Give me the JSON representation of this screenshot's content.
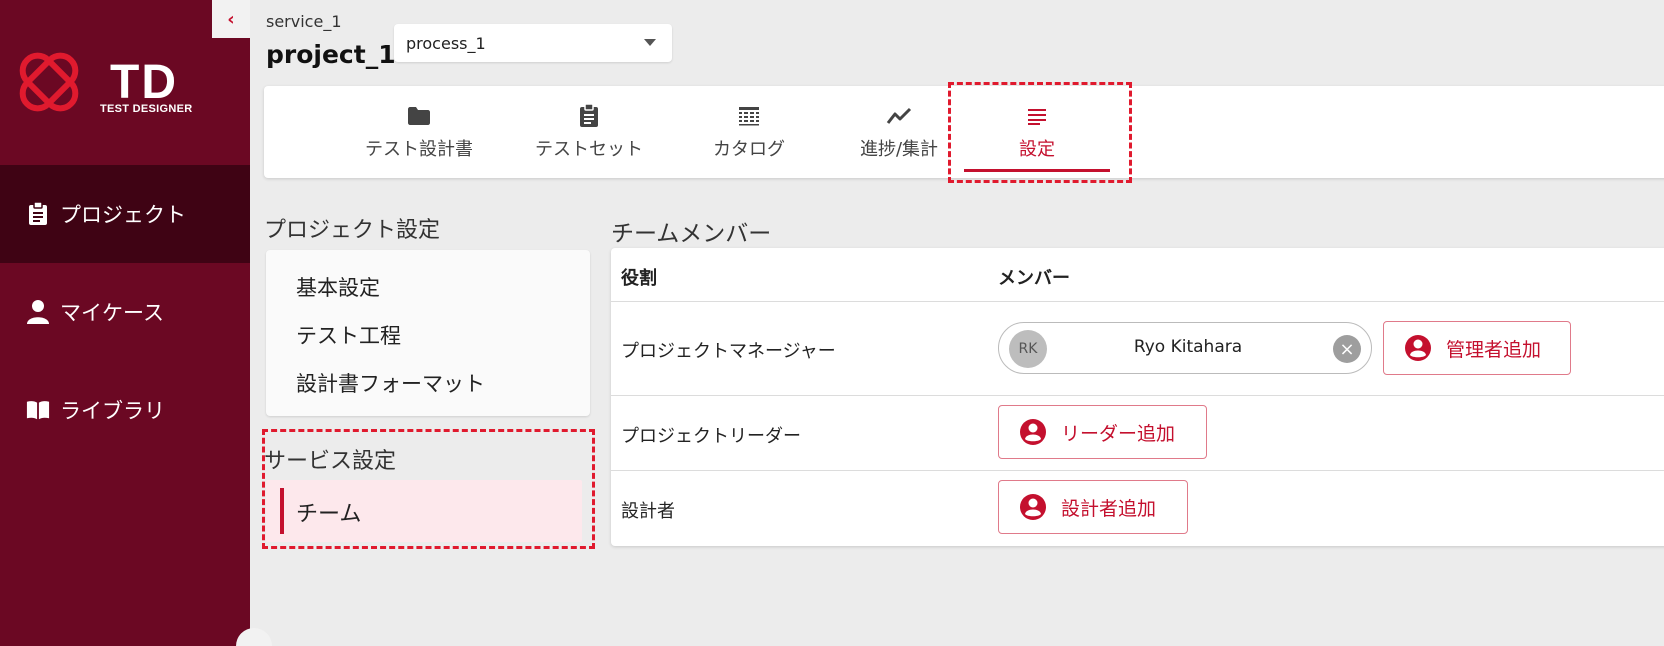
{
  "app": {
    "logo_text": "TD",
    "logo_subtitle": "TEST DESIGNER"
  },
  "sidebar": {
    "items": [
      {
        "label": "プロジェクト",
        "icon": "clipboard-icon",
        "active": true
      },
      {
        "label": "マイケース",
        "icon": "person-icon",
        "active": false
      },
      {
        "label": "ライブラリ",
        "icon": "book-icon",
        "active": false
      }
    ]
  },
  "header": {
    "service": "service_1",
    "project": "project_1",
    "process_select": {
      "value": "process_1"
    }
  },
  "tabs": [
    {
      "label": "テスト設計書",
      "icon": "folder-icon",
      "active": false
    },
    {
      "label": "テストセット",
      "icon": "clipboard-list-icon",
      "active": false
    },
    {
      "label": "カタログ",
      "icon": "table-icon",
      "active": false
    },
    {
      "label": "進捗/集計",
      "icon": "trend-icon",
      "active": false
    },
    {
      "label": "設定",
      "icon": "list-icon",
      "active": true
    }
  ],
  "project_settings": {
    "title": "プロジェクト設定",
    "items": [
      "基本設定",
      "テスト工程",
      "設計書フォーマット"
    ]
  },
  "service_settings": {
    "title": "サービス設定",
    "items": [
      {
        "label": "チーム",
        "active": true
      }
    ]
  },
  "team": {
    "title": "チームメンバー",
    "headers": {
      "role": "役割",
      "member": "メンバー"
    },
    "rows": [
      {
        "role": "プロジェクトマネージャー",
        "members": [
          {
            "initials": "RK",
            "name": "Ryo Kitahara"
          }
        ],
        "add_label": "管理者追加"
      },
      {
        "role": "プロジェクトリーダー",
        "members": [],
        "add_label": "リーダー追加"
      },
      {
        "role": "設計者",
        "members": [],
        "add_label": "設計者追加"
      }
    ]
  },
  "colors": {
    "sidebar": "#6b0823",
    "sidebar_active": "#3f0314",
    "accent": "#c4102e",
    "highlight_dash": "#e01a2e"
  }
}
